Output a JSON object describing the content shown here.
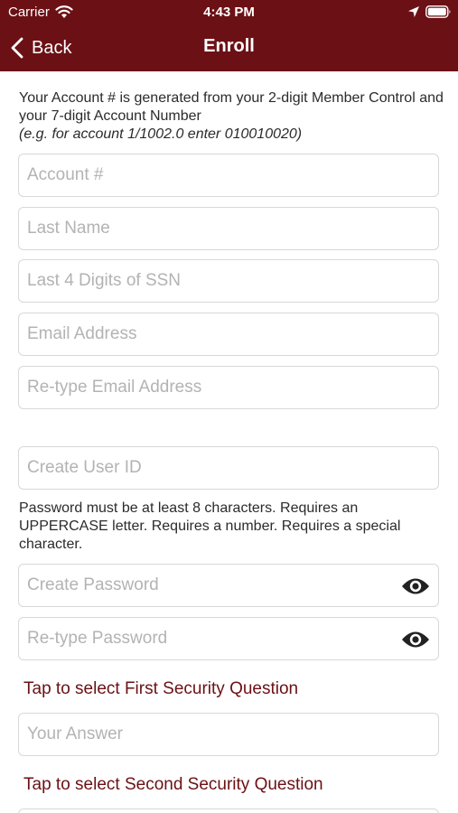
{
  "status_bar": {
    "carrier": "Carrier",
    "time": "4:43 PM",
    "icons": [
      "wifi-icon",
      "location-arrow-icon",
      "battery-icon"
    ]
  },
  "nav": {
    "back_label": "Back",
    "title": "Enroll"
  },
  "intro": {
    "line": "Your Account # is generated from your 2-digit Member Control and your 7-digit Account Number",
    "example": "(e.g. for account 1/1002.0 enter 010010020)"
  },
  "fields": {
    "account": {
      "placeholder": "Account #",
      "value": ""
    },
    "last_name": {
      "placeholder": "Last Name",
      "value": ""
    },
    "ssn": {
      "placeholder": "Last 4 Digits of SSN",
      "value": ""
    },
    "email": {
      "placeholder": "Email Address",
      "value": ""
    },
    "email_confirm": {
      "placeholder": "Re-type Email Address",
      "value": ""
    },
    "user_id": {
      "placeholder": "Create User ID",
      "value": ""
    },
    "password": {
      "placeholder": "Create Password",
      "value": ""
    },
    "password_confirm": {
      "placeholder": "Re-type Password",
      "value": ""
    },
    "answer1": {
      "placeholder": "Your Answer",
      "value": ""
    }
  },
  "password_rules": "Password must be at least 8 characters. Requires an UPPERCASE letter. Requires a number. Requires a special character.",
  "security": {
    "first_question_label": "Tap to select First Security Question",
    "second_question_label": "Tap to select Second Security Question"
  },
  "colors": {
    "brand": "#6b1115",
    "field_border": "#d8d8d8",
    "placeholder": "#b3b3b3",
    "text": "#2b2b2b"
  }
}
